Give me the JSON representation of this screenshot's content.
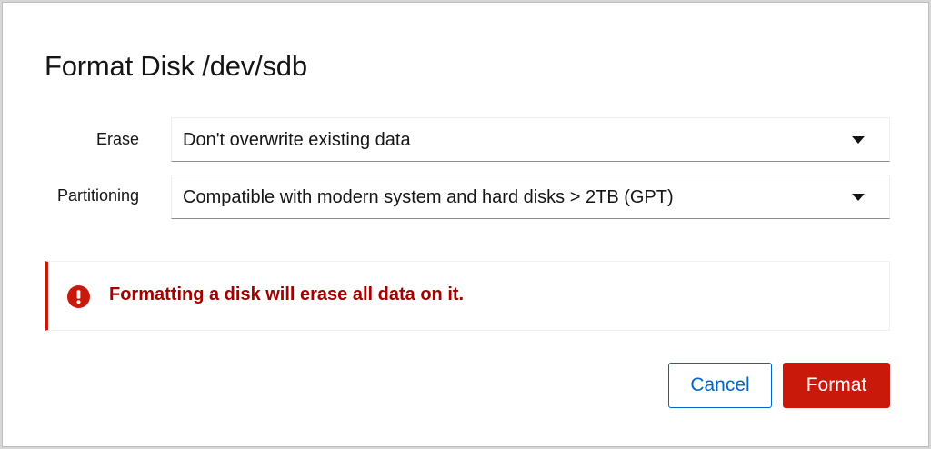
{
  "dialog": {
    "title": "Format Disk /dev/sdb"
  },
  "form": {
    "erase": {
      "label": "Erase",
      "selected": "Don't overwrite existing data"
    },
    "partitioning": {
      "label": "Partitioning",
      "selected": "Compatible with modern system and hard disks > 2TB (GPT)"
    }
  },
  "alert": {
    "type": "danger",
    "icon": "exclamation-circle-icon",
    "message": "Formatting a disk will erase all data on it."
  },
  "actions": {
    "cancel_label": "Cancel",
    "format_label": "Format"
  },
  "colors": {
    "danger": "#c9190b",
    "danger_text": "#a30000",
    "link": "#0066cc"
  }
}
